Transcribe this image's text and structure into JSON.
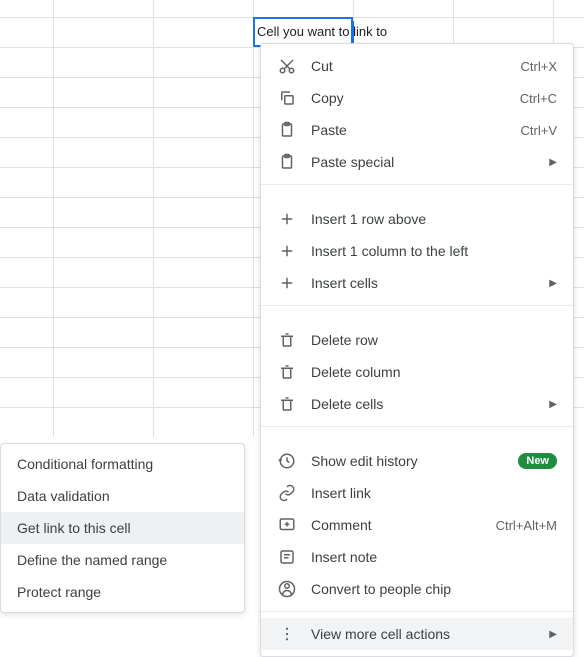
{
  "cell": {
    "value": "Cell you want to link to"
  },
  "menu": {
    "cut": {
      "label": "Cut",
      "shortcut": "Ctrl+X"
    },
    "copy": {
      "label": "Copy",
      "shortcut": "Ctrl+C"
    },
    "paste": {
      "label": "Paste",
      "shortcut": "Ctrl+V"
    },
    "paste_special": {
      "label": "Paste special"
    },
    "insert_row": {
      "label": "Insert 1 row above"
    },
    "insert_col": {
      "label": "Insert 1 column to the left"
    },
    "insert_cells": {
      "label": "Insert cells"
    },
    "delete_row": {
      "label": "Delete row"
    },
    "delete_col": {
      "label": "Delete column"
    },
    "delete_cells": {
      "label": "Delete cells"
    },
    "show_history": {
      "label": "Show edit history",
      "badge": "New"
    },
    "insert_link": {
      "label": "Insert link"
    },
    "comment": {
      "label": "Comment",
      "shortcut": "Ctrl+Alt+M"
    },
    "insert_note": {
      "label": "Insert note"
    },
    "people_chip": {
      "label": "Convert to people chip"
    },
    "view_more": {
      "label": "View more cell actions"
    }
  },
  "submenu": {
    "conditional_formatting": "Conditional formatting",
    "data_validation": "Data validation",
    "get_link": "Get link to this cell",
    "named_range": "Define the named range",
    "protect_range": "Protect range"
  }
}
